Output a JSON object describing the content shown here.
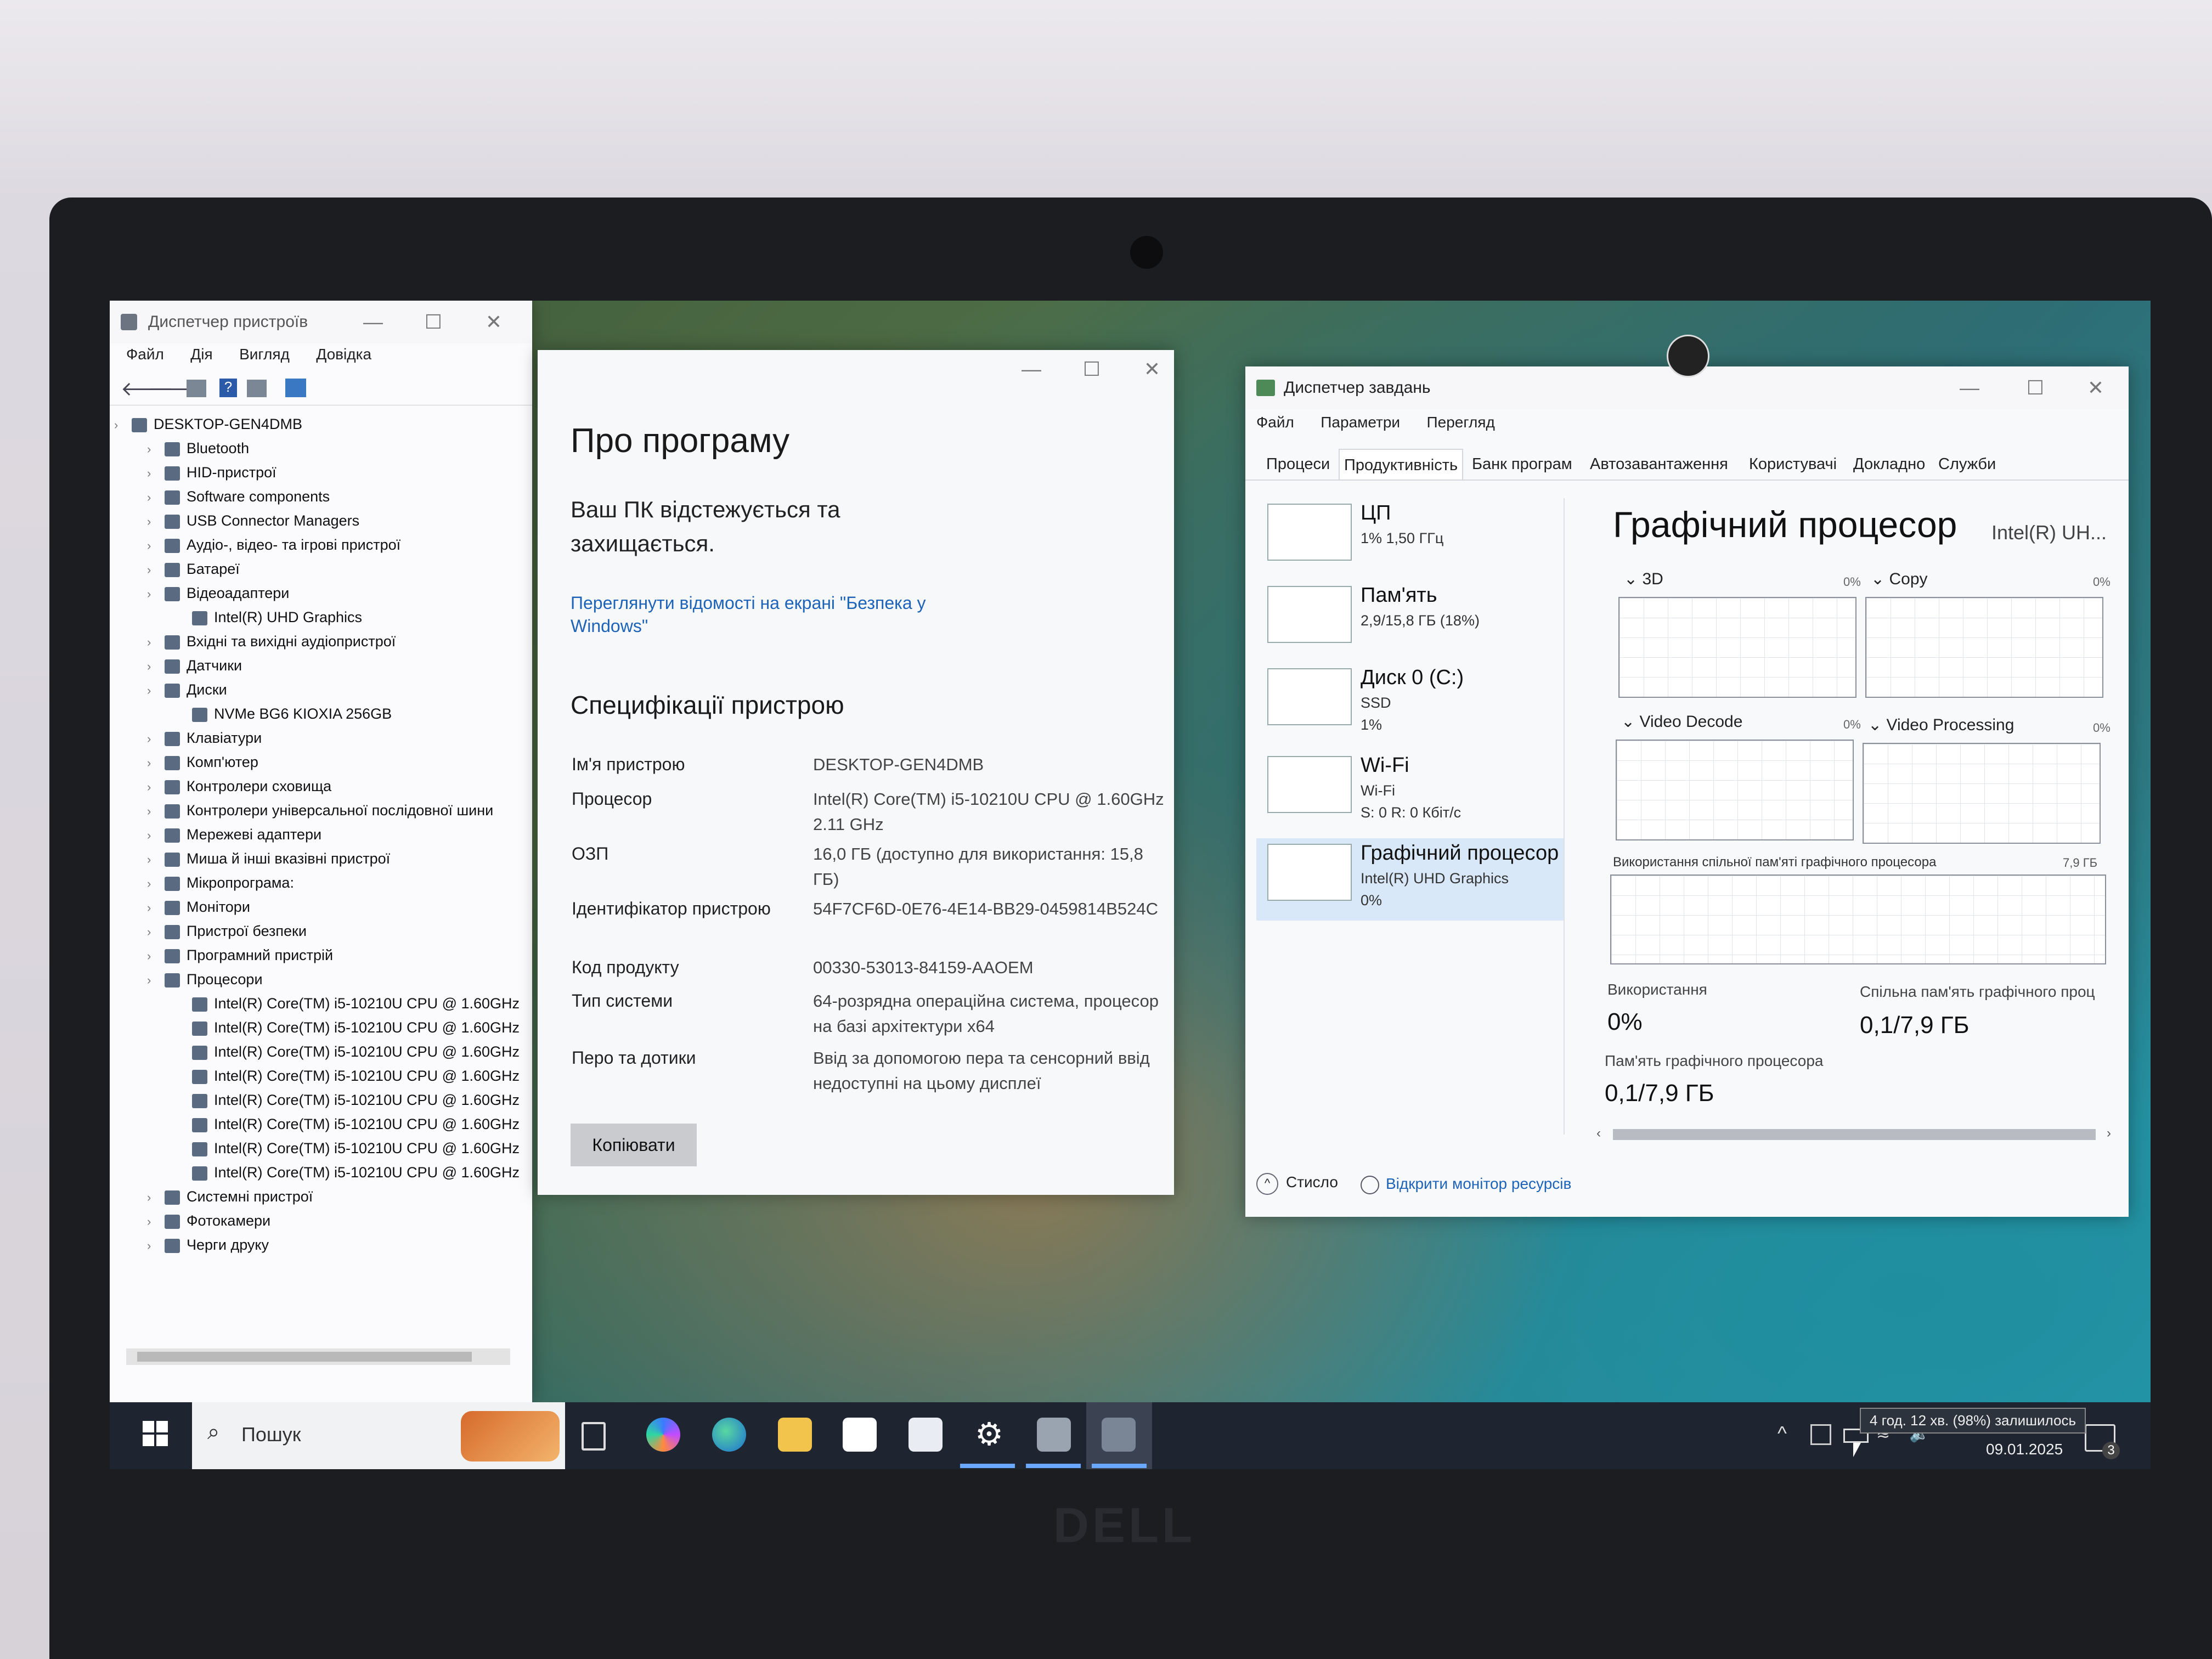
{
  "device_manager": {
    "title": "Диспетчер пристроїв",
    "menu": [
      "Файл",
      "Дія",
      "Вигляд",
      "Довідка"
    ],
    "tree": [
      {
        "label": "DESKTOP-GEN4DMB",
        "level": 0
      },
      {
        "label": "Bluetooth",
        "level": 1
      },
      {
        "label": "HID-пристрої",
        "level": 1
      },
      {
        "label": "Software components",
        "level": 1
      },
      {
        "label": "USB Connector Managers",
        "level": 1
      },
      {
        "label": "Аудіо-, відео- та ігрові пристрої",
        "level": 1
      },
      {
        "label": "Батареї",
        "level": 1
      },
      {
        "label": "Відеоадаптери",
        "level": 1
      },
      {
        "label": "Intel(R) UHD Graphics",
        "level": 2
      },
      {
        "label": "Вхідні та вихідні аудіопристрої",
        "level": 1
      },
      {
        "label": "Датчики",
        "level": 1
      },
      {
        "label": "Диски",
        "level": 1
      },
      {
        "label": "NVMe BG6 KIOXIA 256GB",
        "level": 2
      },
      {
        "label": "Клавіатури",
        "level": 1
      },
      {
        "label": "Комп'ютер",
        "level": 1
      },
      {
        "label": "Контролери сховища",
        "level": 1
      },
      {
        "label": "Контролери універсальної послідовної шини",
        "level": 1
      },
      {
        "label": "Мережеві адаптери",
        "level": 1
      },
      {
        "label": "Миша й інші вказівні пристрої",
        "level": 1
      },
      {
        "label": "Мікропрограма:",
        "level": 1
      },
      {
        "label": "Монітори",
        "level": 1
      },
      {
        "label": "Пристрої безпеки",
        "level": 1
      },
      {
        "label": "Програмний пристрій",
        "level": 1
      },
      {
        "label": "Процесори",
        "level": 1
      },
      {
        "label": "Intel(R) Core(TM) i5-10210U CPU @ 1.60GHz",
        "level": 2
      },
      {
        "label": "Intel(R) Core(TM) i5-10210U CPU @ 1.60GHz",
        "level": 2
      },
      {
        "label": "Intel(R) Core(TM) i5-10210U CPU @ 1.60GHz",
        "level": 2
      },
      {
        "label": "Intel(R) Core(TM) i5-10210U CPU @ 1.60GHz",
        "level": 2
      },
      {
        "label": "Intel(R) Core(TM) i5-10210U CPU @ 1.60GHz",
        "level": 2
      },
      {
        "label": "Intel(R) Core(TM) i5-10210U CPU @ 1.60GHz",
        "level": 2
      },
      {
        "label": "Intel(R) Core(TM) i5-10210U CPU @ 1.60GHz",
        "level": 2
      },
      {
        "label": "Intel(R) Core(TM) i5-10210U CPU @ 1.60GHz",
        "level": 2
      },
      {
        "label": "Системні пристрої",
        "level": 1
      },
      {
        "label": "Фотокамери",
        "level": 1
      },
      {
        "label": "Черги друку",
        "level": 1
      }
    ]
  },
  "about": {
    "heading": "Про програму",
    "protected": "Ваш ПК відстежується та захищається.",
    "security_link": "Переглянути відомості на екрані \"Безпека у Windows\"",
    "specs_heading": "Специфікації пристрою",
    "specs": [
      {
        "label": "Ім'я пристрою",
        "value": "DESKTOP-GEN4DMB"
      },
      {
        "label": "Процесор",
        "value": "Intel(R) Core(TM) i5-10210U CPU @ 1.60GHz   2.11 GHz"
      },
      {
        "label": "ОЗП",
        "value": "16,0 ГБ (доступно для використання: 15,8 ГБ)"
      },
      {
        "label": "Ідентифікатор пристрою",
        "value": "54F7CF6D-0E76-4E14-BB29-0459814B524C"
      },
      {
        "label": "Код продукту",
        "value": "00330-53013-84159-AAOEM"
      },
      {
        "label": "Тип системи",
        "value": "64-розрядна операційна система, процесор на базі архітектури x64"
      },
      {
        "label": "Перо та дотики",
        "value": "Ввід за допомогою пера та сенсорний ввід недоступні на цьому дисплеї"
      }
    ],
    "copy_button": "Копіювати"
  },
  "task_manager": {
    "title": "Диспетчер завдань",
    "menu": [
      "Файл",
      "Параметри",
      "Перегляд"
    ],
    "tabs": [
      "Процеси",
      "Продуктивність",
      "Банк програм",
      "Автозавантаження",
      "Користувачі",
      "Докладно",
      "Служби"
    ],
    "active_tab": "Продуктивність",
    "sidebar": [
      {
        "name": "ЦП",
        "line1": "1% 1,50 ГГц",
        "line2": ""
      },
      {
        "name": "Пам'ять",
        "line1": "2,9/15,8 ГБ (18%)",
        "line2": ""
      },
      {
        "name": "Диск 0 (C:)",
        "line1": "SSD",
        "line2": "1%"
      },
      {
        "name": "Wi-Fi",
        "line1": "Wi-Fi",
        "line2": "S: 0 R: 0 Кбіт/с"
      },
      {
        "name": "Графічний процесор",
        "line1": "Intel(R) UHD Graphics",
        "line2": "0%"
      }
    ],
    "gpu_heading": "Графічний процесор",
    "gpu_model": "Intel(R) UH...",
    "engines": [
      {
        "name": "3D",
        "value": "0%"
      },
      {
        "name": "Copy",
        "value": "0%"
      },
      {
        "name": "Video Decode",
        "value": "0%"
      },
      {
        "name": "Video Processing",
        "value": "0%"
      }
    ],
    "shared_graph_label": "Використання спільної пам'яті графічного процесора",
    "shared_graph_max": "7,9 ГБ",
    "usage_label": "Використання",
    "usage_value": "0%",
    "shared_mem_label": "Спільна пам'ять графічного проц",
    "shared_mem_value": "0,1/7,9 ГБ",
    "gpu_mem_label": "Пам'ять графічного процесора",
    "gpu_mem_value": "0,1/7,9 ГБ",
    "fewer_details": "Стисло",
    "open_monitor": "Відкрити монітор ресурсів"
  },
  "taskbar": {
    "search_placeholder": "Пошук",
    "battery_tooltip": "4 год. 12 хв. (98%) залишилось",
    "date": "09.01.2025",
    "notification_count": "3"
  },
  "laptop": {
    "brand": "DELL"
  }
}
